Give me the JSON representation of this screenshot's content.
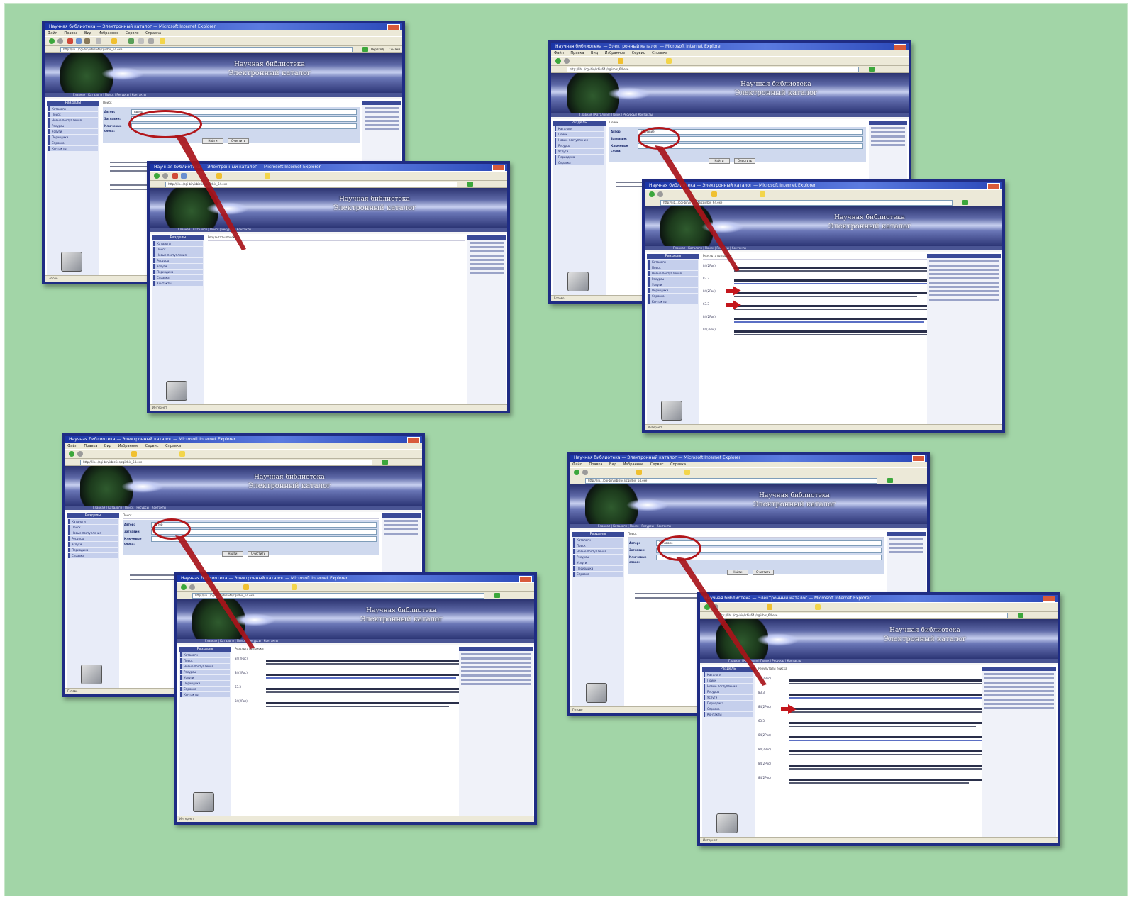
{
  "browser": {
    "title": "Научная библиотека — Электронный каталог — Microsoft Internet Explorer",
    "menu": [
      "Файл",
      "Правка",
      "Вид",
      "Избранное",
      "Сервис",
      "Справка"
    ],
    "address": "http://lib.../cgi-bin/irbis64r/cgiirbis_64.exe",
    "go_label": "Переход",
    "links_label": "Ссылки",
    "status_ready": "Готово",
    "status_zone": "Интернет"
  },
  "site": {
    "banner_line1": "Научная библиотека",
    "banner_line2": "Электронный каталог",
    "nav_links": "Главная | Каталоги | Поиск | Ресурсы | Контакты"
  },
  "sidebar": {
    "heading": "Разделы",
    "items": [
      "Каталоги",
      "Поиск",
      "Новые поступления",
      "Ресурсы",
      "Услуги",
      "Периодика",
      "Справка",
      "Контакты"
    ]
  },
  "search_form": {
    "crumb": "Поиск",
    "fields": [
      "Автор:",
      "Заглавие:",
      "Ключевые слова:"
    ],
    "submit_label": "Найти",
    "reset_label": "Очистить",
    "queries": [
      "Автор",
      "Заглавие",
      "Автор",
      "Заглавие"
    ]
  },
  "results": {
    "crumb": "Результаты поиска",
    "codes": [
      "84(2Рос)",
      "83.3",
      "84(2Рос)",
      "63.3",
      "84(2Рос)",
      "84(2Рос)"
    ]
  }
}
